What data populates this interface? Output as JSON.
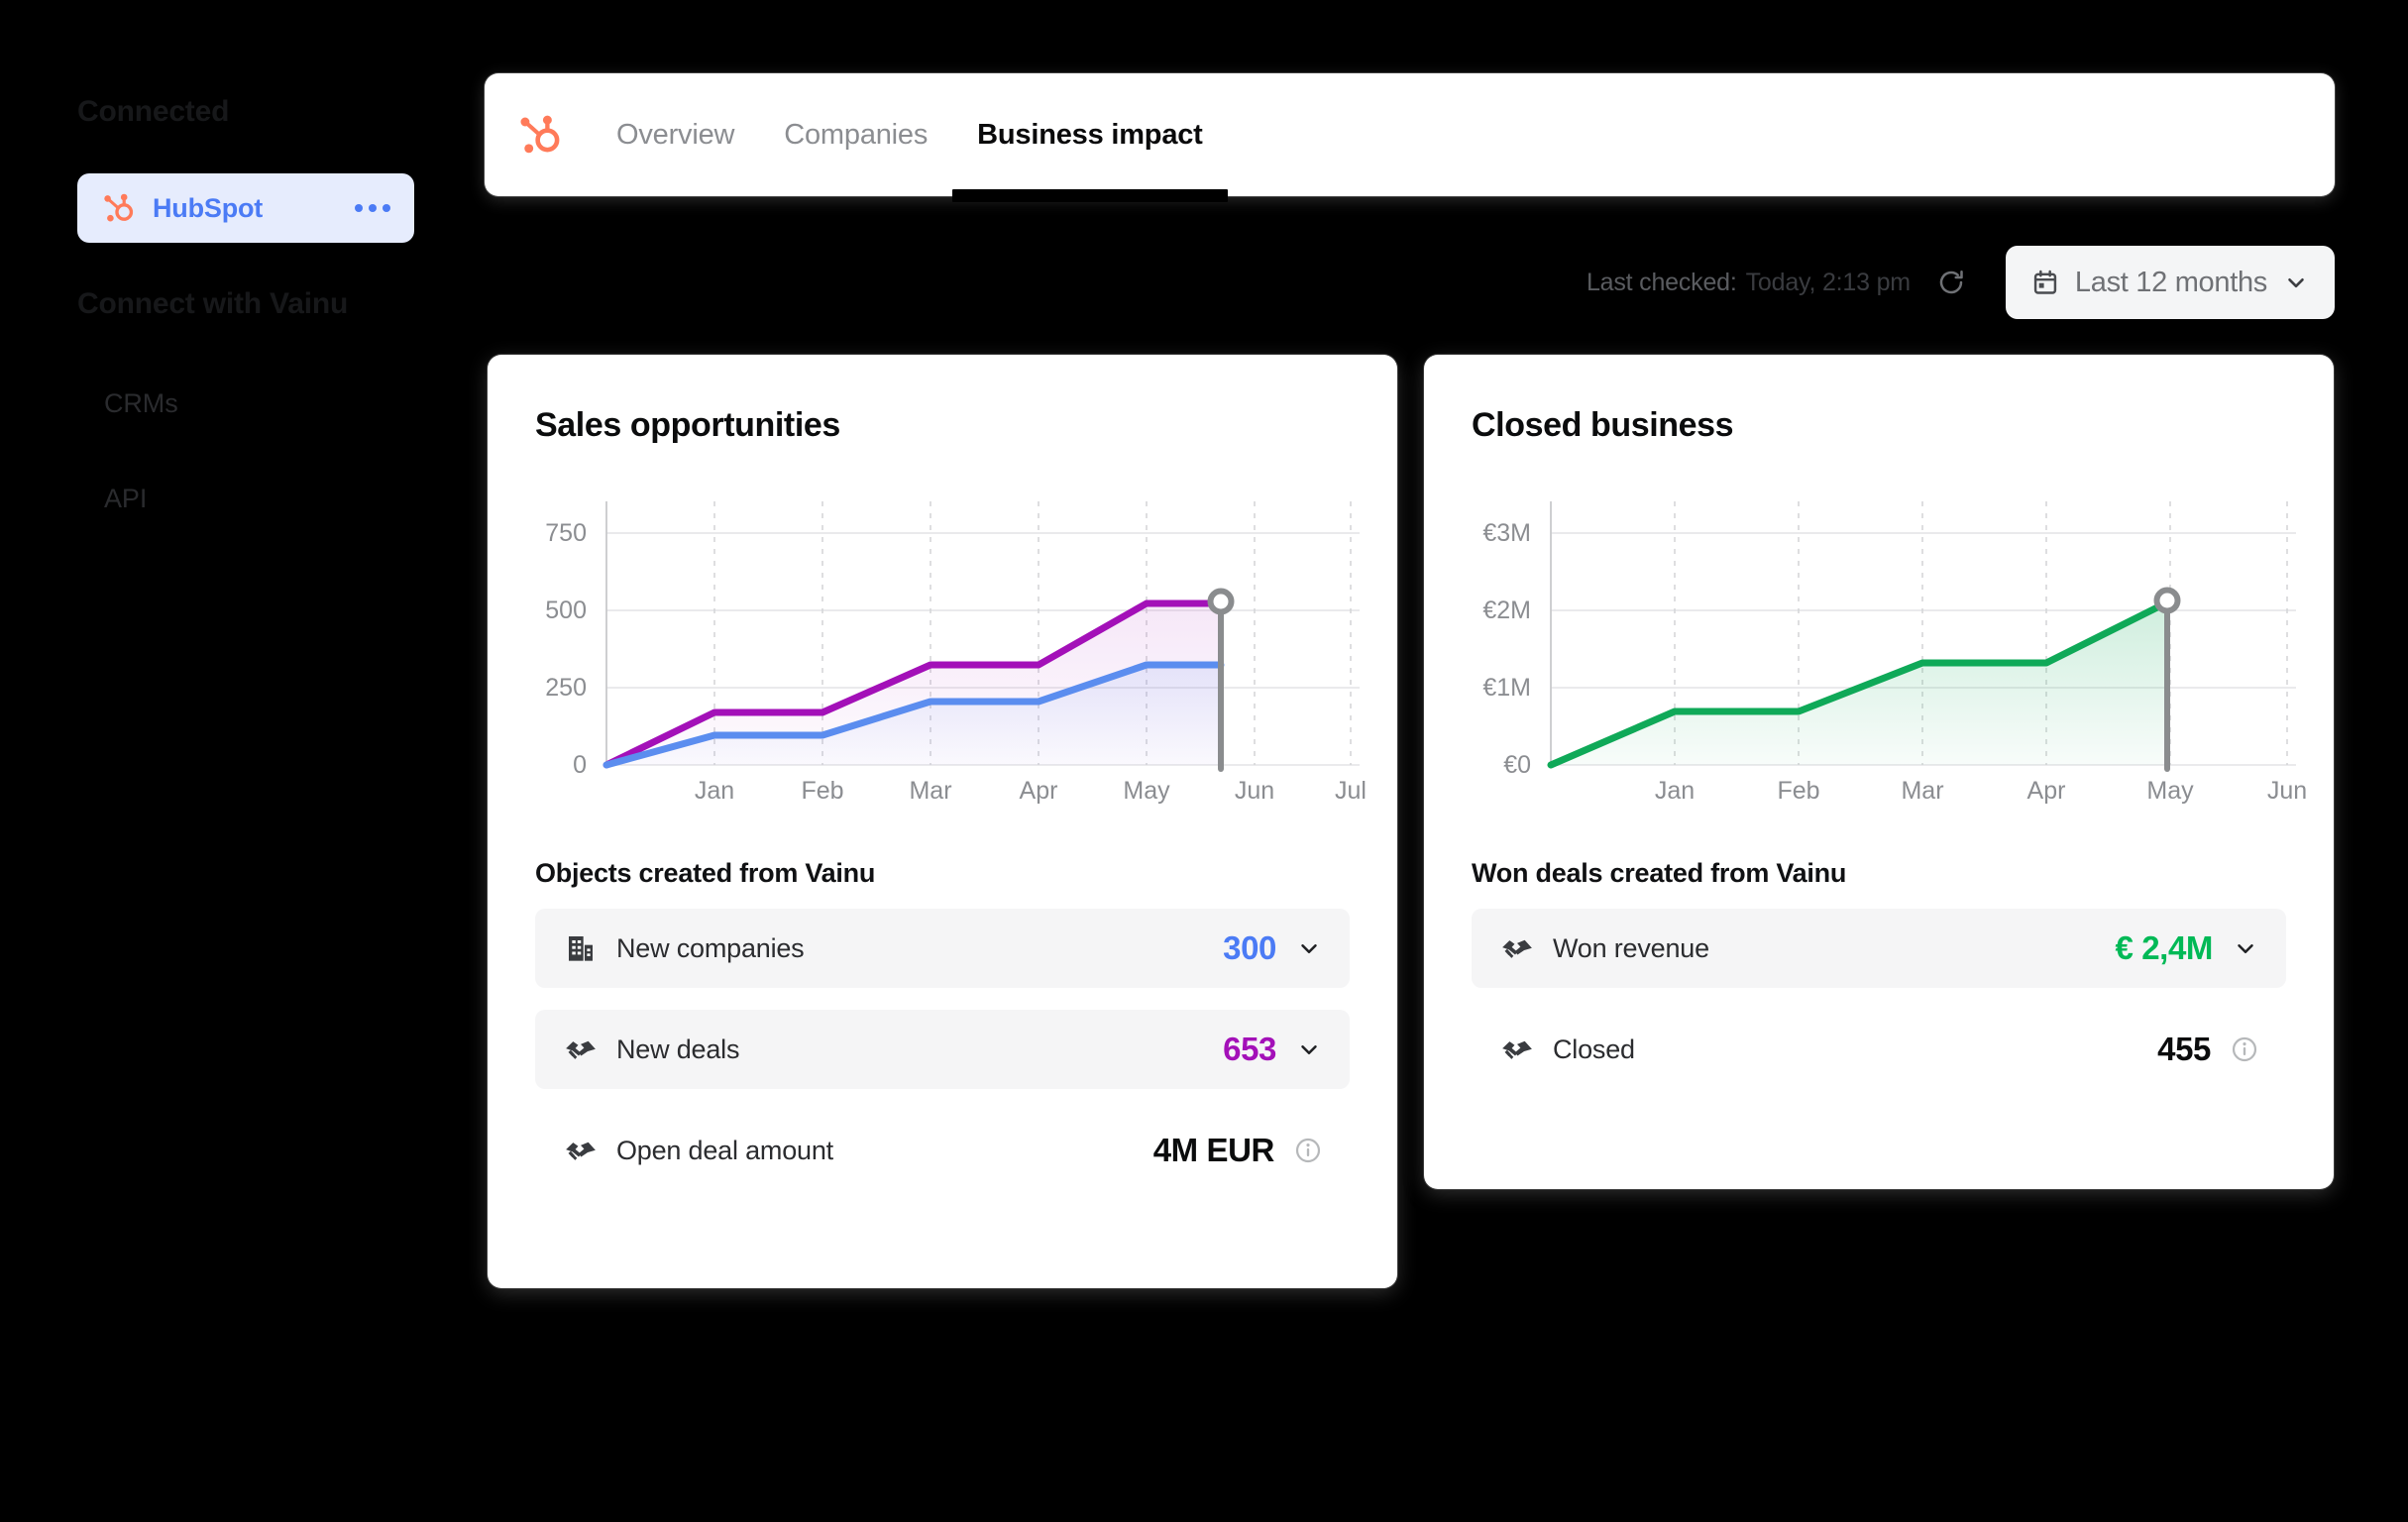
{
  "sidebar": {
    "heading_connected": "Connected",
    "heading_connect": "Connect with Vainu",
    "active_item": {
      "label": "HubSpot",
      "icon": "hubspot-logo-icon",
      "menu_icon": "more-options-icon"
    },
    "links": [
      {
        "label": "CRMs"
      },
      {
        "label": "API"
      }
    ]
  },
  "topbar": {
    "logo_icon": "hubspot-logo-icon",
    "tabs": [
      {
        "label": "Overview",
        "active": false
      },
      {
        "label": "Companies",
        "active": false
      },
      {
        "label": "Business impact",
        "active": true
      }
    ]
  },
  "meta": {
    "last_checked_label": "Last checked:",
    "last_checked_value": "Today, 2:13 pm",
    "refresh_icon": "refresh-icon",
    "date_filter": {
      "label": "Last 12 months",
      "icon": "calendar-icon",
      "chevron": "chevron-down-icon"
    }
  },
  "cards": {
    "left": {
      "title": "Sales opportunities",
      "metrics_heading": "Objects created from Vainu",
      "rows": [
        {
          "icon": "building-icon",
          "label": "New companies",
          "value": "300",
          "value_color": "blue",
          "shaded": true,
          "affordance": "chevron-down-icon"
        },
        {
          "icon": "handshake-icon",
          "label": "New deals",
          "value": "653",
          "value_color": "purple",
          "shaded": true,
          "affordance": "chevron-down-icon"
        },
        {
          "icon": "handshake-icon",
          "label": "Open deal amount",
          "value": "4M EUR",
          "value_color": "dark",
          "shaded": false,
          "affordance": "info-icon"
        }
      ]
    },
    "right": {
      "title": "Closed business",
      "metrics_heading": "Won deals created from Vainu",
      "rows": [
        {
          "icon": "handshake-icon",
          "label": "Won revenue",
          "value": "€ 2,4M",
          "value_color": "green",
          "shaded": true,
          "affordance": "chevron-down-icon"
        },
        {
          "icon": "handshake-icon",
          "label": "Closed",
          "value": "455",
          "value_color": "dark",
          "shaded": false,
          "affordance": "info-icon"
        }
      ]
    }
  },
  "colors": {
    "hubspot_orange": "#ff7a59",
    "accent_blue": "#4b7bf5",
    "series_purple": "#a310b8",
    "series_blue": "#5b8def",
    "series_green": "#0fa958",
    "marker_gray": "#8a8c8e",
    "background": "#000000",
    "card_bg": "#ffffff"
  },
  "chart_data": [
    {
      "type": "area",
      "title": "Sales opportunities",
      "xlabel": "",
      "ylabel": "",
      "x": [
        "Jan",
        "Feb",
        "Mar",
        "Apr",
        "May",
        "Jun",
        "Jul"
      ],
      "xtick_labels": [
        "Jan",
        "Feb",
        "Mar",
        "Apr",
        "May",
        "Jun",
        "Jul"
      ],
      "ytick_labels": [
        "0",
        "250",
        "500",
        "750"
      ],
      "yticks": [
        0,
        250,
        500,
        750
      ],
      "ylim": [
        0,
        840
      ],
      "grid": true,
      "legend": "none",
      "marker_month": "Jun",
      "series": [
        {
          "name": "New deals",
          "color": "#a310b8",
          "values": [
            0,
            170,
            170,
            325,
            325,
            525,
            525
          ]
        },
        {
          "name": "New companies",
          "color": "#5b8def",
          "values": [
            0,
            95,
            95,
            205,
            205,
            325,
            325
          ]
        }
      ]
    },
    {
      "type": "area",
      "title": "Closed business",
      "xlabel": "",
      "ylabel": "",
      "x": [
        "Jan",
        "Feb",
        "Mar",
        "Apr",
        "May",
        "Jun"
      ],
      "xtick_labels": [
        "Jan",
        "Feb",
        "Mar",
        "Apr",
        "May",
        "Jun"
      ],
      "ytick_labels": [
        "€0",
        "€1M",
        "€2M",
        "€3M"
      ],
      "yticks": [
        0,
        1000000,
        2000000,
        3000000
      ],
      "ylim": [
        0,
        3350000
      ],
      "grid": true,
      "legend": "none",
      "marker_month": "May",
      "series": [
        {
          "name": "Won revenue",
          "color": "#0fa958",
          "values": [
            0,
            690000,
            690000,
            1320000,
            1320000,
            2100000
          ]
        }
      ]
    }
  ]
}
